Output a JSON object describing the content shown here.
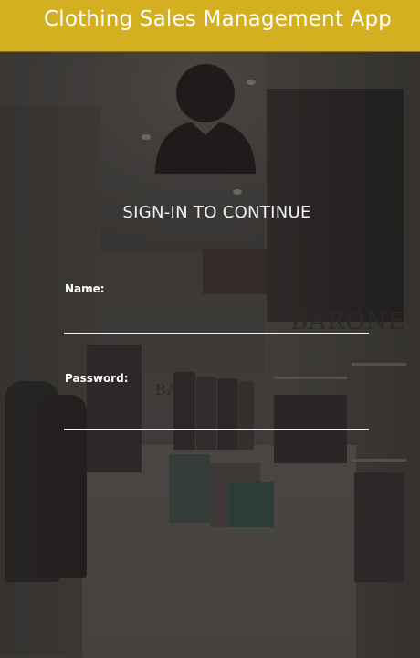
{
  "header": {
    "title": "Clothing Sales Management App",
    "background_color": "#d4b021"
  },
  "background": {
    "brand_sign": "BARONE",
    "brand_sign_small": "BA"
  },
  "avatar": {
    "icon": "user-silhouette-icon"
  },
  "signin": {
    "title": "SIGN-IN TO CONTINUE"
  },
  "form": {
    "name_label": "Name:",
    "name_value": "",
    "password_label": "Password:",
    "password_value": ""
  }
}
